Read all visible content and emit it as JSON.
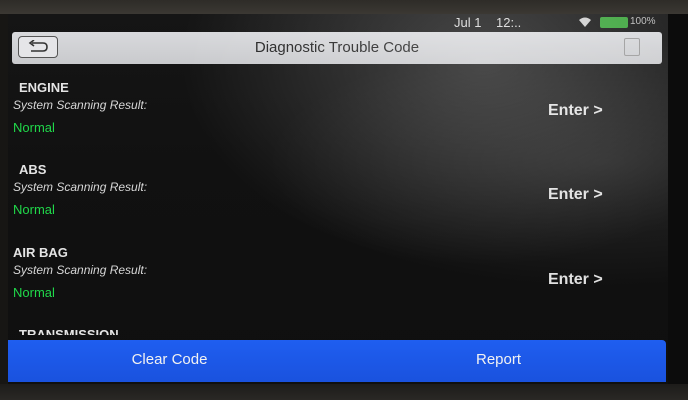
{
  "status_bar": {
    "date": "Jul 1",
    "time": "12:..",
    "battery": "100%"
  },
  "header": {
    "title": "Diagnostic Trouble Code"
  },
  "systems": [
    {
      "name": "ENGINE",
      "scan_label": "System Scanning Result:",
      "result": "Normal",
      "action": "Enter >"
    },
    {
      "name": "ABS",
      "scan_label": "System Scanning Result:",
      "result": "Normal",
      "action": "Enter >"
    },
    {
      "name": "AIR BAG",
      "scan_label": "System Scanning Result:",
      "result": "Normal",
      "action": "Enter >"
    },
    {
      "name": "TRANSMISSION"
    }
  ],
  "footer": {
    "clear_label": "Clear Code",
    "report_label": "Report"
  },
  "colors": {
    "accent_blue": "#1f5ef0",
    "normal_green": "#20d84a",
    "title_bar": "#d8d9dc"
  },
  "icons": [
    "back-arrow-icon",
    "save-icon",
    "wifi-icon",
    "battery-icon"
  ]
}
